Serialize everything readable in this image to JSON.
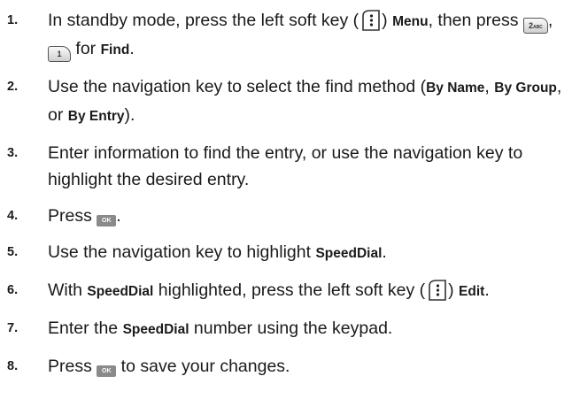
{
  "steps": [
    {
      "num": "1.",
      "t1": "In standby mode, press the left soft key (",
      "t2": ") ",
      "menu": "Menu",
      "t3": ", then press ",
      "key2": "2",
      "key2_sub": "ABC",
      "t4": ", ",
      "key1": "1",
      "t5": " for ",
      "find": "Find",
      "t6": "."
    },
    {
      "num": "2.",
      "t1": "Use the navigation key to select the find method (",
      "by_name": "By Name",
      "sep1": ", ",
      "by_group": "By Group",
      "sep2": ", or ",
      "by_entry": "By Entry",
      "t2": ")."
    },
    {
      "num": "3.",
      "t1": "Enter information to find the entry, or use the navigation key to highlight the desired entry."
    },
    {
      "num": "4.",
      "t1": "Press ",
      "ok": "OK",
      "t2": "."
    },
    {
      "num": "5.",
      "t1": "Use the navigation key to highlight ",
      "b1": "SpeedDial",
      "t2": "."
    },
    {
      "num": "6.",
      "t1": "With ",
      "b1": "SpeedDial",
      "t2": " highlighted, press the left soft key (",
      "t3": ") ",
      "edit": "Edit",
      "t4": "."
    },
    {
      "num": "7.",
      "t1": "Enter the ",
      "b1": "SpeedDial",
      "t2": " number using the keypad."
    },
    {
      "num": "8.",
      "t1": "Press ",
      "ok": "OK",
      "t2": " to save your changes."
    }
  ],
  "icons": {
    "soft_key": "left-soft-key-icon",
    "ok_key": "ok-key-icon"
  }
}
